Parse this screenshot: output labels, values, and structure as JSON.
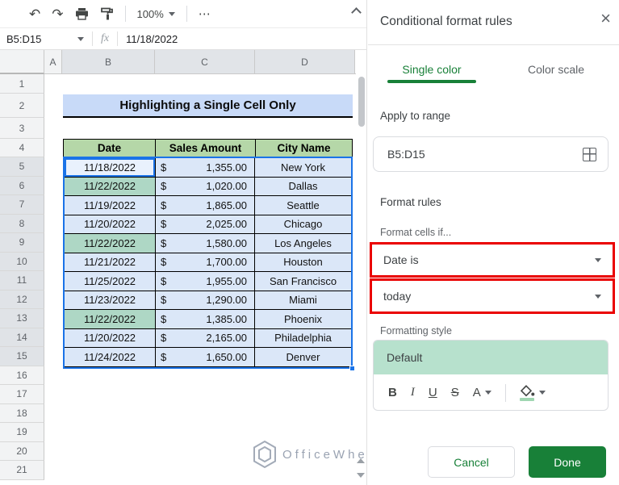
{
  "toolbar": {
    "icons": {
      "undo": "↶",
      "redo": "↷"
    },
    "zoom_level": "100%",
    "more_label": "⋯"
  },
  "formula_bar": {
    "name_box": "B5:D15",
    "fx_label": "fx",
    "value": "11/18/2022"
  },
  "grid": {
    "columns": [
      "A",
      "B",
      "C",
      "D"
    ],
    "row_numbers": [
      "1",
      "2",
      "3",
      "4",
      "5",
      "6",
      "7",
      "8",
      "9",
      "10",
      "11",
      "12",
      "13",
      "14",
      "15",
      "16",
      "17",
      "18",
      "19",
      "20",
      "21"
    ]
  },
  "sheet": {
    "title": "Highlighting a Single Cell Only",
    "table": {
      "headers": [
        "Date",
        "Sales Amount",
        "City Name"
      ],
      "currency": "$",
      "rows": [
        {
          "date": "11/18/2022",
          "amount": "1,355.00",
          "city": "New York",
          "highlight": false
        },
        {
          "date": "11/22/2022",
          "amount": "1,020.00",
          "city": "Dallas",
          "highlight": true
        },
        {
          "date": "11/19/2022",
          "amount": "1,865.00",
          "city": "Seattle",
          "highlight": false
        },
        {
          "date": "11/20/2022",
          "amount": "2,025.00",
          "city": "Chicago",
          "highlight": false
        },
        {
          "date": "11/22/2022",
          "amount": "1,580.00",
          "city": "Los Angeles",
          "highlight": true
        },
        {
          "date": "11/21/2022",
          "amount": "1,700.00",
          "city": "Houston",
          "highlight": false
        },
        {
          "date": "11/25/2022",
          "amount": "1,955.00",
          "city": "San Francisco",
          "highlight": false
        },
        {
          "date": "11/23/2022",
          "amount": "1,290.00",
          "city": "Miami",
          "highlight": false
        },
        {
          "date": "11/22/2022",
          "amount": "1,385.00",
          "city": "Phoenix",
          "highlight": true
        },
        {
          "date": "11/20/2022",
          "amount": "2,165.00",
          "city": "Philadelphia",
          "highlight": false
        },
        {
          "date": "11/24/2022",
          "amount": "1,650.00",
          "city": "Denver",
          "highlight": false
        }
      ]
    },
    "watermark": "OfficeWheel"
  },
  "panel": {
    "title": "Conditional format rules",
    "close_glyph": "×",
    "tabs": [
      {
        "label": "Single color",
        "active": true
      },
      {
        "label": "Color scale",
        "active": false
      }
    ],
    "apply_to_range_label": "Apply to range",
    "range_value": "B5:D15",
    "format_rules_label": "Format rules",
    "format_cells_if_label": "Format cells if...",
    "condition_dropdown": "Date is",
    "condition_value_dropdown": "today",
    "formatting_style_label": "Formatting style",
    "style_preview": "Default",
    "format_buttons": {
      "bold": "B",
      "italic": "I",
      "underline": "U",
      "strikethrough": "S",
      "text_color": "A"
    },
    "cancel_label": "Cancel",
    "done_label": "Done"
  },
  "colors": {
    "accent_green": "#188038",
    "annotation_red": "#ea0000",
    "selection_blue": "#1a73e8",
    "table_header_green": "#b5d7a8",
    "data_row_blue": "#dbe7f8",
    "conditional_highlight_green": "#aed7c5",
    "title_banner_blue": "#c8daf8",
    "style_preview_green": "#b7e1cd"
  }
}
